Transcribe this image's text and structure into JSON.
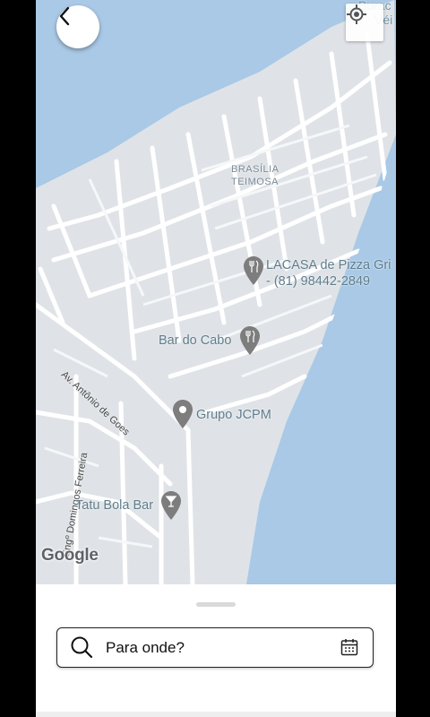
{
  "map": {
    "neighborhood": [
      "BRASÍLIA",
      "TEIMOSA"
    ],
    "corner_label": [
      "Burac",
      "Véi"
    ],
    "street_1": "Av. Antônio de Goes",
    "street_2": "Engº Domingos Ferreira",
    "pois": [
      {
        "name_line1": "LACASA de Pizza Gri",
        "name_line2": "- (81) 98442-2849",
        "icon": "restaurant-icon"
      },
      {
        "name": "Bar do Cabo",
        "icon": "restaurant-icon"
      },
      {
        "name": "Grupo JCPM",
        "icon": "place-pin-icon"
      },
      {
        "name": "Tatu Bola Bar",
        "icon": "bar-icon"
      }
    ],
    "watermark": "Google",
    "colors": {
      "water": "#a9c9e6",
      "land": "#dfe3e7",
      "roads": "#ffffff",
      "poi_text": "#5f7d8c"
    }
  },
  "controls": {
    "back_icon": "chevron-left-icon",
    "locate_icon": "my-location-icon"
  },
  "search": {
    "placeholder": "Para onde?",
    "search_icon": "search-icon",
    "calendar_icon": "calendar-icon"
  }
}
